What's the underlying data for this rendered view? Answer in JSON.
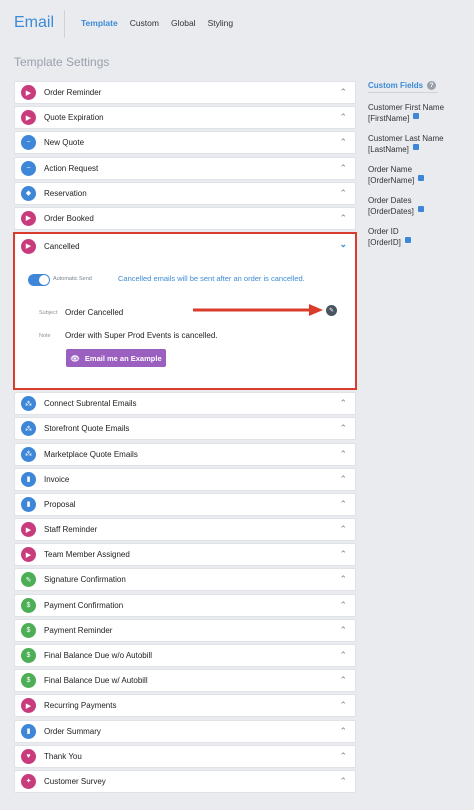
{
  "app": {
    "title": "Email"
  },
  "tabs": [
    {
      "label": "Template",
      "active": true
    },
    {
      "label": "Custom",
      "active": false
    },
    {
      "label": "Global",
      "active": false
    },
    {
      "label": "Styling",
      "active": false
    }
  ],
  "section_title": "Template Settings",
  "templates_before": [
    {
      "label": "Order Reminder",
      "color": "#c83c7d",
      "icon": "play-icon"
    },
    {
      "label": "Quote Expiration",
      "color": "#c83c7d",
      "icon": "play-icon"
    },
    {
      "label": "New Quote",
      "color": "#3e86d8",
      "icon": "minus-circle-icon"
    },
    {
      "label": "Action Request",
      "color": "#3e86d8",
      "icon": "minus-circle-icon"
    },
    {
      "label": "Reservation",
      "color": "#3e86d8",
      "icon": "tag-icon"
    },
    {
      "label": "Order Booked",
      "color": "#c83c7d",
      "icon": "play-icon"
    }
  ],
  "expanded": {
    "label": "Cancelled",
    "icon": "play-icon",
    "automatic_send_label": "Automatic Send",
    "automatic_send_on": true,
    "info": "Cancelled emails will be sent after an order is cancelled.",
    "subject_label": "Subject",
    "subject_value": "Order Cancelled",
    "note_label": "Note",
    "note_value": "Order with Super Prod Events is cancelled.",
    "example_button": "Email me an Example"
  },
  "templates_after": [
    {
      "label": "Connect Subrental Emails",
      "color": "#3e86d8",
      "icon": "network-icon"
    },
    {
      "label": "Storefront Quote Emails",
      "color": "#3e86d8",
      "icon": "network-icon"
    },
    {
      "label": "Marketplace Quote Emails",
      "color": "#3e86d8",
      "icon": "network-icon"
    },
    {
      "label": "Invoice",
      "color": "#3e86d8",
      "icon": "document-icon"
    },
    {
      "label": "Proposal",
      "color": "#3e86d8",
      "icon": "document-icon"
    },
    {
      "label": "Staff Reminder",
      "color": "#c83c7d",
      "icon": "play-icon"
    },
    {
      "label": "Team Member Assigned",
      "color": "#c83c7d",
      "icon": "play-icon"
    },
    {
      "label": "Signature Confirmation",
      "color": "#4cae55",
      "icon": "pen-icon"
    },
    {
      "label": "Payment Confirmation",
      "color": "#4cae55",
      "icon": "dollar-icon"
    },
    {
      "label": "Payment Reminder",
      "color": "#4cae55",
      "icon": "dollar-icon"
    },
    {
      "label": "Final Balance Due w/o Autobill",
      "color": "#4cae55",
      "icon": "dollar-icon"
    },
    {
      "label": "Final Balance Due w/ Autobill",
      "color": "#4cae55",
      "icon": "dollar-icon"
    },
    {
      "label": "Recurring Payments",
      "color": "#c83c7d",
      "icon": "play-icon"
    },
    {
      "label": "Order Summary",
      "color": "#3e86d8",
      "icon": "document-icon"
    },
    {
      "label": "Thank You",
      "color": "#c83c7d",
      "icon": "heart-icon"
    },
    {
      "label": "Customer Survey",
      "color": "#c83c7d",
      "icon": "star-icon"
    }
  ],
  "custom_fields": {
    "title": "Custom Fields",
    "items": [
      {
        "name": "Customer First Name",
        "token": "[FirstName]"
      },
      {
        "name": "Customer Last Name",
        "token": "[LastName]"
      },
      {
        "name": "Order Name",
        "token": "[OrderName]"
      },
      {
        "name": "Order Dates",
        "token": "[OrderDates]"
      },
      {
        "name": "Order ID",
        "token": "[OrderID]"
      }
    ]
  }
}
